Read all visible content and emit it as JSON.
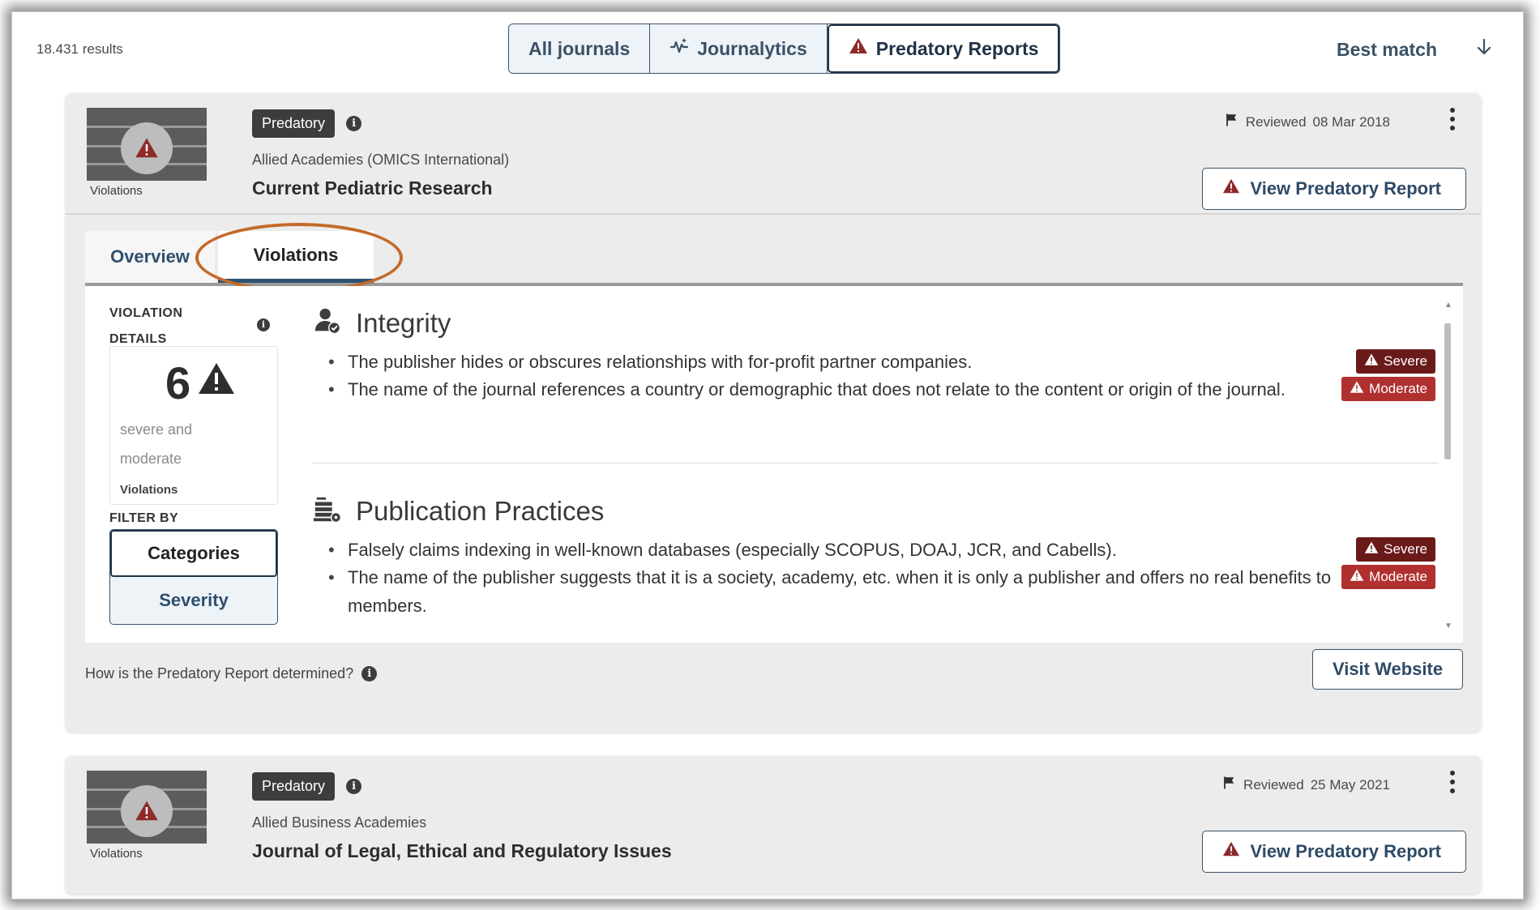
{
  "toolbar": {
    "results": "18.431 results",
    "tabs": [
      {
        "label": "All journals",
        "icon": "none"
      },
      {
        "label": "Journalytics",
        "icon": "pulse-sparkle-icon"
      },
      {
        "label": "Predatory Reports",
        "icon": "warning-triangle-icon"
      }
    ],
    "sort_label": "Best match",
    "sort_icon": "arrow-down-icon"
  },
  "cards": [
    {
      "thumb_label": "Violations",
      "tag": "Predatory",
      "publisher": "Allied Academies (OMICS International)",
      "title": "Current Pediatric Research",
      "reviewed_label": "Reviewed",
      "reviewed_date": "08 Mar 2018",
      "report_button": "View Predatory Report",
      "tabs": {
        "overview": "Overview",
        "violations": "Violations"
      },
      "details": {
        "title_line1": "VIOLATION",
        "title_line2": "DETAILS",
        "count": "6",
        "sub1": "severe and",
        "sub2": "moderate",
        "count_label": "Violations",
        "filter_label": "FILTER BY",
        "filters": [
          "Categories",
          "Severity"
        ]
      },
      "sections": [
        {
          "title": "Integrity",
          "icon": "user-check-icon",
          "items": [
            {
              "text": "The publisher hides or obscures relationships with for-profit partner companies.",
              "severity": "Severe"
            },
            {
              "text": "The name of the journal references a country or demographic that does not relate to the content or origin of the journal.",
              "severity": "Moderate"
            }
          ]
        },
        {
          "title": "Publication Practices",
          "icon": "publication-stack-icon",
          "items": [
            {
              "text": "Falsely claims indexing in well-known databases (especially SCOPUS, DOAJ, JCR, and Cabells).",
              "severity": "Severe"
            },
            {
              "text": "The name of the publisher suggests that it is a society, academy, etc. when it is only a publisher and offers no real benefits to members.",
              "severity": "Moderate"
            }
          ]
        }
      ],
      "footer_question": "How is the Predatory Report determined?",
      "visit_button": "Visit Website"
    },
    {
      "thumb_label": "Violations",
      "tag": "Predatory",
      "publisher": "Allied Business Academies",
      "title": "Journal of Legal, Ethical and Regulatory Issues",
      "reviewed_label": "Reviewed",
      "reviewed_date": "25 May 2021",
      "report_button": "View Predatory Report"
    }
  ],
  "colors": {
    "accent": "#2f4f6e",
    "severe": "#6b1a1a",
    "moderate": "#b03030",
    "highlight_ring": "#c46a2a"
  }
}
